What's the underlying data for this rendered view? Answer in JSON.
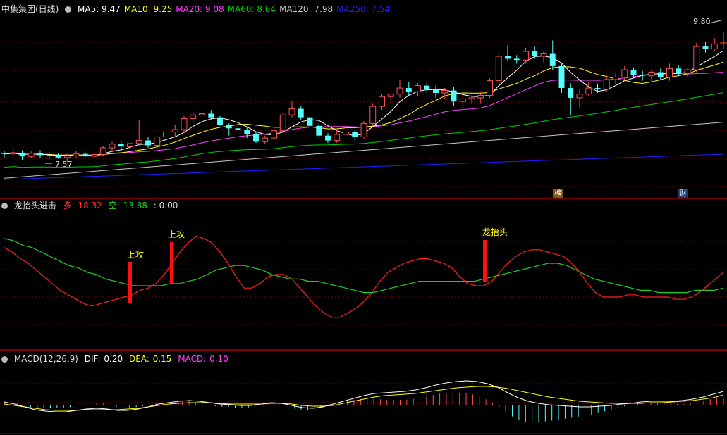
{
  "colors": {
    "up": "#ff5252",
    "down": "#54ffff",
    "grid": "#7a0000",
    "border": "#a00000",
    "ma5": "#ffffff",
    "ma10": "#ffff00",
    "ma20": "#ff40ff",
    "ma60": "#00d000",
    "ma120": "#c8c8c8",
    "ma250": "#2020ff",
    "bull": "#ff2020",
    "bear": "#20d020",
    "dif": "#ffffff",
    "dea": "#ffff00",
    "macd": "#ff40ff"
  },
  "main_panel": {
    "title": "中集集团(日线)",
    "indicators": [
      {
        "label": "MA5:",
        "value": "9.47",
        "color": "#ffffff"
      },
      {
        "label": "MA10:",
        "value": "9.25",
        "color": "#ffff00"
      },
      {
        "label": "MA20:",
        "value": "9.08",
        "color": "#ff40ff"
      },
      {
        "label": "MA60:",
        "value": "8.64",
        "color": "#00d000"
      },
      {
        "label": "MA120:",
        "value": "7.98",
        "color": "#c8c8c8"
      },
      {
        "label": "MA250:",
        "value": "7.54",
        "color": "#2020ff"
      }
    ],
    "high_label": "9.80",
    "low_label": "7.57",
    "event_badge_1": "榜",
    "event_badge_2": "财"
  },
  "sub_panel_1": {
    "title": "龙抬头进击",
    "bull_label": "多:",
    "bull_value": "18.32",
    "bear_label": "空:",
    "bear_value": "13.88",
    "extra": ": 0.00",
    "signals": [
      "上攻",
      "上攻",
      "龙抬头"
    ]
  },
  "sub_panel_2": {
    "title": "MACD(12,26,9)",
    "dif_label": "DIF:",
    "dif_value": "0.20",
    "dea_label": "DEA:",
    "dea_value": "0.15",
    "macd_label": "MACD:",
    "macd_value": "0.10"
  },
  "chart_data": [
    {
      "type": "candlestick",
      "title": "中集集团(日线)",
      "ylim": [
        7.3,
        10.0
      ],
      "candles": [
        [
          7.82,
          7.85,
          7.74,
          7.8
        ],
        [
          7.8,
          7.88,
          7.76,
          7.82
        ],
        [
          7.82,
          7.86,
          7.7,
          7.76
        ],
        [
          7.76,
          7.84,
          7.73,
          7.81
        ],
        [
          7.81,
          7.86,
          7.74,
          7.78
        ],
        [
          7.78,
          7.83,
          7.71,
          7.77
        ],
        [
          7.77,
          7.81,
          7.72,
          7.74
        ],
        [
          7.74,
          7.8,
          7.66,
          7.77
        ],
        [
          7.77,
          7.85,
          7.74,
          7.8
        ],
        [
          7.8,
          7.84,
          7.73,
          7.76
        ],
        [
          7.76,
          7.82,
          7.7,
          7.79
        ],
        [
          7.79,
          7.93,
          7.77,
          7.9
        ],
        [
          7.9,
          8.0,
          7.85,
          7.96
        ],
        [
          7.96,
          8.02,
          7.88,
          7.92
        ],
        [
          7.92,
          8.0,
          7.86,
          7.97
        ],
        [
          7.97,
          8.35,
          7.93,
          8.02
        ],
        [
          8.02,
          8.08,
          7.9,
          7.94
        ],
        [
          7.94,
          8.1,
          7.88,
          8.08
        ],
        [
          8.08,
          8.2,
          8.02,
          8.16
        ],
        [
          8.16,
          8.28,
          8.08,
          8.2
        ],
        [
          8.2,
          8.42,
          8.14,
          8.38
        ],
        [
          8.38,
          8.5,
          8.32,
          8.44
        ],
        [
          8.44,
          8.52,
          8.36,
          8.46
        ],
        [
          8.46,
          8.52,
          8.36,
          8.4
        ],
        [
          8.4,
          8.42,
          8.26,
          8.28
        ],
        [
          8.28,
          8.3,
          8.1,
          8.22
        ],
        [
          8.22,
          8.26,
          8.16,
          8.2
        ],
        [
          8.2,
          8.24,
          8.06,
          8.12
        ],
        [
          8.12,
          8.16,
          7.98,
          8.0
        ],
        [
          8.0,
          8.1,
          7.96,
          8.06
        ],
        [
          8.06,
          8.22,
          8.0,
          8.18
        ],
        [
          8.18,
          8.48,
          8.14,
          8.44
        ],
        [
          8.44,
          8.66,
          8.4,
          8.54
        ],
        [
          8.54,
          8.58,
          8.36,
          8.4
        ],
        [
          8.4,
          8.44,
          8.2,
          8.26
        ],
        [
          8.26,
          8.3,
          8.06,
          8.1
        ],
        [
          8.1,
          8.14,
          7.98,
          8.02
        ],
        [
          8.02,
          8.2,
          7.98,
          8.12
        ],
        [
          8.12,
          8.24,
          8.02,
          8.16
        ],
        [
          8.16,
          8.2,
          8.0,
          8.08
        ],
        [
          8.08,
          8.34,
          8.04,
          8.3
        ],
        [
          8.3,
          8.62,
          8.26,
          8.58
        ],
        [
          8.58,
          8.78,
          8.52,
          8.74
        ],
        [
          8.74,
          8.8,
          8.64,
          8.78
        ],
        [
          8.78,
          9.02,
          8.72,
          8.88
        ],
        [
          8.88,
          8.98,
          8.76,
          8.82
        ],
        [
          8.82,
          8.96,
          8.74,
          8.92
        ],
        [
          8.92,
          8.98,
          8.8,
          8.86
        ],
        [
          8.86,
          8.92,
          8.72,
          8.8
        ],
        [
          8.8,
          8.88,
          8.7,
          8.84
        ],
        [
          8.84,
          8.9,
          8.58,
          8.66
        ],
        [
          8.66,
          8.74,
          8.56,
          8.7
        ],
        [
          8.7,
          8.76,
          8.62,
          8.72
        ],
        [
          8.72,
          8.82,
          8.62,
          8.76
        ],
        [
          8.76,
          9.04,
          8.72,
          9.0
        ],
        [
          9.0,
          9.44,
          8.96,
          9.4
        ],
        [
          9.4,
          9.58,
          9.32,
          9.36
        ],
        [
          9.36,
          9.42,
          9.28,
          9.34
        ],
        [
          9.34,
          9.54,
          9.28,
          9.48
        ],
        [
          9.48,
          9.56,
          9.36,
          9.4
        ],
        [
          9.4,
          9.48,
          9.3,
          9.44
        ],
        [
          9.44,
          9.66,
          9.18,
          9.24
        ],
        [
          9.24,
          9.28,
          8.8,
          8.88
        ],
        [
          8.88,
          8.96,
          8.44,
          8.72
        ],
        [
          8.72,
          8.86,
          8.56,
          8.78
        ],
        [
          8.78,
          8.98,
          8.74,
          8.88
        ],
        [
          8.88,
          8.94,
          8.8,
          8.86
        ],
        [
          8.86,
          9.08,
          8.82,
          9.02
        ],
        [
          9.02,
          9.12,
          8.94,
          9.06
        ],
        [
          9.06,
          9.24,
          9.0,
          9.18
        ],
        [
          9.18,
          9.22,
          9.04,
          9.1
        ],
        [
          9.1,
          9.16,
          9.0,
          9.08
        ],
        [
          9.08,
          9.18,
          8.98,
          9.14
        ],
        [
          9.14,
          9.2,
          9.02,
          9.06
        ],
        [
          9.06,
          9.28,
          9.0,
          9.2
        ],
        [
          9.2,
          9.26,
          9.08,
          9.12
        ],
        [
          9.12,
          9.2,
          9.06,
          9.18
        ],
        [
          9.18,
          9.62,
          9.14,
          9.56
        ],
        [
          9.56,
          9.64,
          9.46,
          9.52
        ],
        [
          9.52,
          9.7,
          9.48,
          9.6
        ],
        [
          9.6,
          9.8,
          9.52,
          9.62
        ]
      ]
    },
    {
      "type": "line",
      "title": "龙抬头进击",
      "series": [
        {
          "name": "多",
          "values": [
            62,
            60,
            57,
            55,
            52,
            49,
            46,
            43,
            41,
            39,
            37,
            36,
            37,
            38,
            39,
            40,
            41,
            43,
            44,
            46,
            50,
            55,
            60,
            64,
            67,
            66,
            64,
            60,
            55,
            49,
            44,
            44,
            46,
            49,
            50,
            50,
            48,
            44,
            40,
            36,
            33,
            31,
            31,
            33,
            35,
            38,
            42,
            47,
            51,
            53,
            55,
            56,
            57,
            57,
            56,
            55,
            53,
            49,
            46,
            45,
            45,
            47,
            51,
            55,
            58,
            60,
            61,
            61,
            60,
            59,
            58,
            55,
            51,
            46,
            42,
            40,
            40,
            40,
            41,
            41,
            40,
            40,
            40,
            40,
            39,
            39,
            40,
            42,
            45,
            48,
            51
          ]
        },
        {
          "name": "空",
          "values": [
            66,
            65,
            63,
            62,
            60,
            58,
            56,
            54,
            53,
            51,
            50,
            48,
            47,
            46,
            45,
            45,
            45,
            45,
            46,
            46,
            47,
            48,
            50,
            52,
            53,
            54,
            54,
            53,
            52,
            50,
            49,
            48,
            48,
            47,
            47,
            46,
            45,
            44,
            43,
            42,
            42,
            43,
            44,
            45,
            46,
            47,
            47,
            47,
            47,
            47,
            47,
            47,
            48,
            49,
            50,
            51,
            52,
            53,
            54,
            55,
            55,
            54,
            52,
            50,
            48,
            47,
            46,
            45,
            44,
            43,
            43,
            42,
            42,
            42,
            42,
            43,
            43,
            43,
            44
          ]
        }
      ],
      "signals": [
        "上攻",
        "上攻",
        "龙抬头"
      ]
    },
    {
      "type": "line",
      "title": "MACD(12,26,9)",
      "series": [
        {
          "name": "DIF",
          "values": [
            0.05,
            0.02,
            -0.02,
            -0.06,
            -0.08,
            -0.09,
            -0.09,
            -0.07,
            -0.05,
            -0.04,
            -0.05,
            -0.07,
            -0.07,
            -0.05,
            -0.02,
            0.02,
            0.04,
            0.06,
            0.07,
            0.06,
            0.04,
            0.02,
            0.01,
            0.0,
            0.0,
            0.02,
            0.04,
            0.03,
            0.0,
            -0.03,
            -0.04,
            -0.02,
            0.02,
            0.06,
            0.1,
            0.14,
            0.17,
            0.18,
            0.19,
            0.2,
            0.22,
            0.25,
            0.29,
            0.32,
            0.34,
            0.35,
            0.34,
            0.31,
            0.26,
            0.18,
            0.11,
            0.06,
            0.03,
            0.01,
            0.0,
            -0.01,
            -0.02,
            -0.02,
            -0.01,
            0.0,
            0.02,
            0.03,
            0.05,
            0.06,
            0.06,
            0.06,
            0.07,
            0.09,
            0.12,
            0.16,
            0.2
          ]
        },
        {
          "name": "DEA",
          "values": [
            0.02,
            0.0,
            -0.02,
            -0.04,
            -0.06,
            -0.07,
            -0.07,
            -0.07,
            -0.06,
            -0.06,
            -0.06,
            -0.06,
            -0.05,
            -0.04,
            -0.02,
            0.0,
            0.02,
            0.03,
            0.04,
            0.04,
            0.04,
            0.03,
            0.02,
            0.02,
            0.02,
            0.02,
            0.03,
            0.03,
            0.02,
            0.0,
            -0.01,
            -0.01,
            0.0,
            0.03,
            0.06,
            0.09,
            0.12,
            0.14,
            0.15,
            0.16,
            0.17,
            0.19,
            0.21,
            0.23,
            0.25,
            0.26,
            0.27,
            0.27,
            0.26,
            0.24,
            0.21,
            0.18,
            0.15,
            0.12,
            0.1,
            0.08,
            0.06,
            0.05,
            0.04,
            0.03,
            0.03,
            0.03,
            0.03,
            0.04,
            0.04,
            0.05,
            0.06,
            0.07,
            0.09,
            0.11,
            0.15
          ]
        }
      ]
    }
  ]
}
